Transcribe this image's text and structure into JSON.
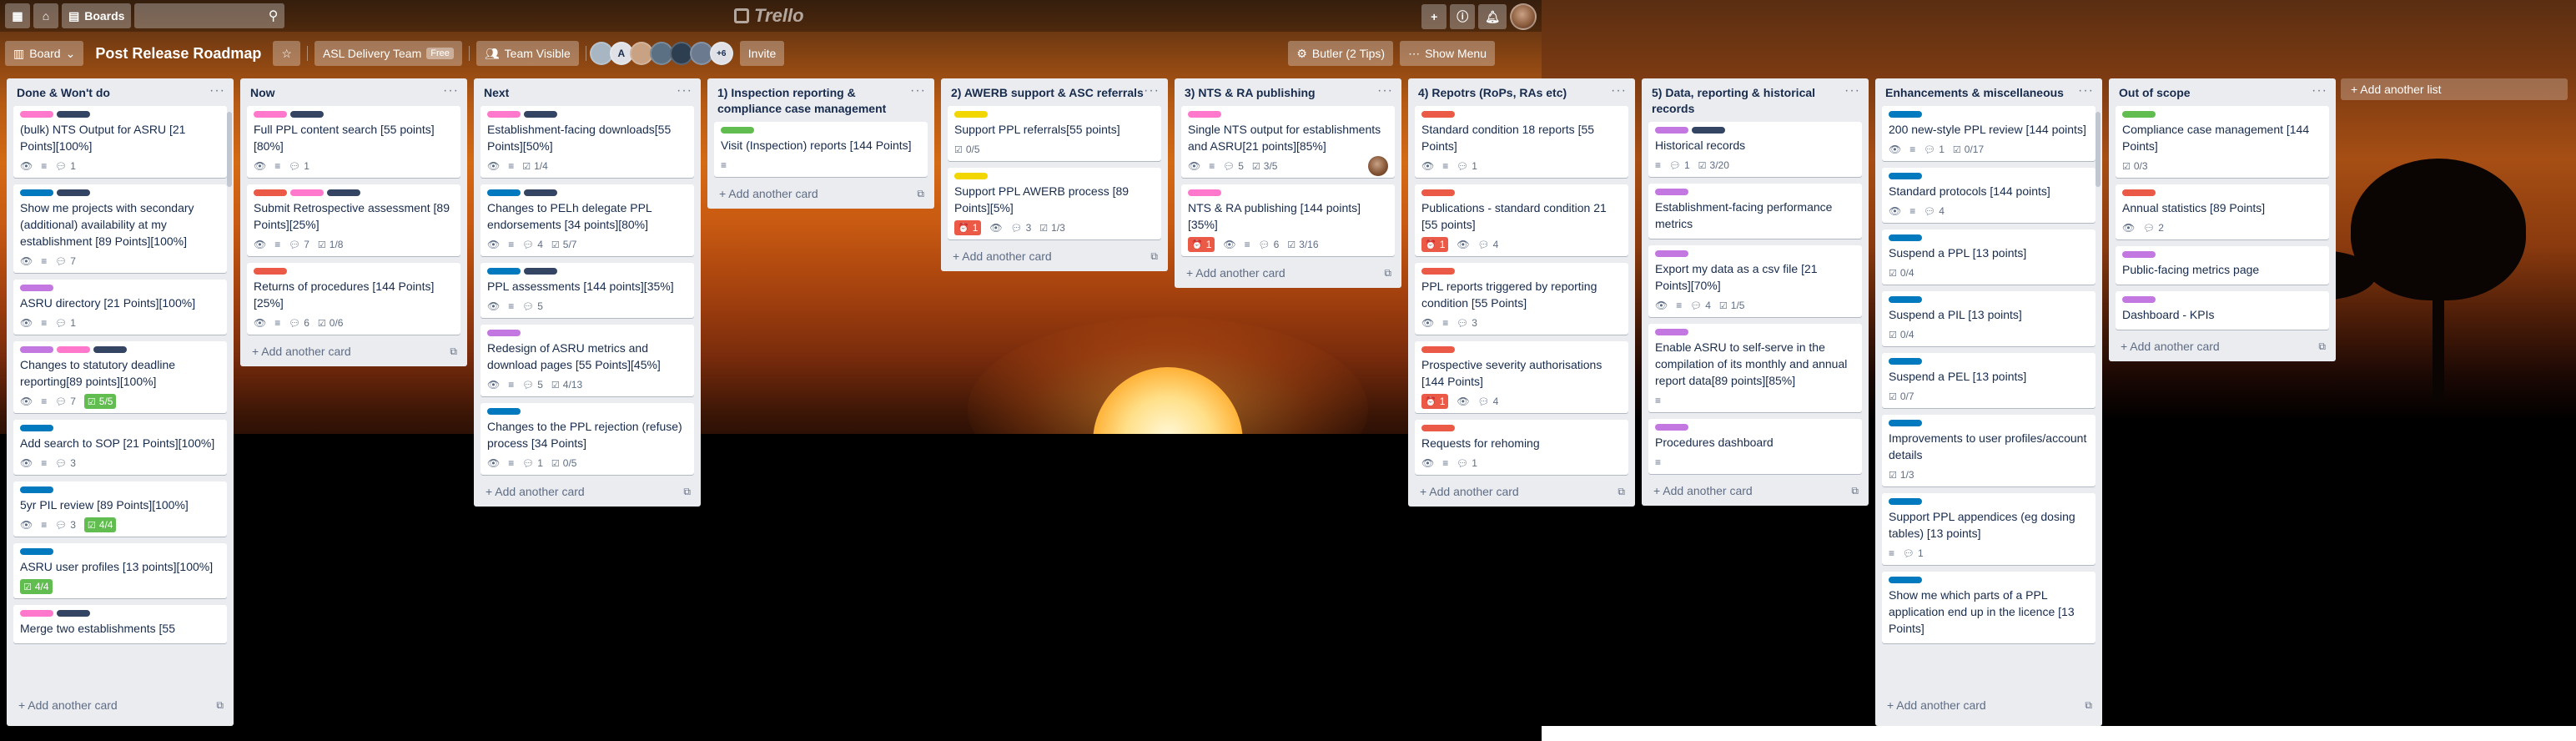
{
  "header": {
    "boards_label": "Boards",
    "logo_text": "Trello"
  },
  "boardbar": {
    "view_label": "Board",
    "title": "Post Release Roadmap",
    "team": "ASL Delivery Team",
    "team_badge": "Free",
    "visibility": "Team Visible",
    "member_initial": "A",
    "more_members": "+6",
    "invite": "Invite",
    "butler": "Butler (2 Tips)",
    "show_menu": "Show Menu"
  },
  "add_card_label": "+ Add another card",
  "add_list_label": "+ Add another list",
  "lists": [
    {
      "title": "Done & Won't do",
      "cards": [
        {
          "labels": [
            "pink",
            "navy"
          ],
          "title": "(bulk) NTS Output for ASRU [21 Points][100%]",
          "watch": true,
          "desc": true,
          "comments": "1"
        },
        {
          "labels": [
            "blue",
            "navy"
          ],
          "title": "Show me projects with secondary (additional) availability at my establishment [89 Points][100%]",
          "watch": true,
          "desc": true,
          "comments": "7"
        },
        {
          "labels": [
            "purple"
          ],
          "title": "ASRU directory [21 Points][100%]",
          "watch": true,
          "desc": true,
          "comments": "1"
        },
        {
          "labels": [
            "purple",
            "pink",
            "navy"
          ],
          "title": "Changes to statutory deadline reporting[89 points][100%]",
          "watch": true,
          "desc": true,
          "comments": "7",
          "checklist_done": "5/5"
        },
        {
          "labels": [
            "blue"
          ],
          "title": "Add search to SOP [21 Points][100%]",
          "watch": true,
          "desc": true,
          "comments": "3"
        },
        {
          "labels": [
            "blue"
          ],
          "title": "5yr PIL review [89 Points][100%]",
          "watch": true,
          "desc": true,
          "comments": "3",
          "checklist_done": "4/4"
        },
        {
          "labels": [
            "blue"
          ],
          "title": "ASRU user profiles [13 points][100%]",
          "checklist_done": "4/4"
        },
        {
          "labels": [
            "pink",
            "navy"
          ],
          "title": "Merge two establishments [55"
        }
      ]
    },
    {
      "title": "Now",
      "cards": [
        {
          "labels": [
            "pink",
            "navy"
          ],
          "title": "Full PPL content search [55 points][80%]",
          "watch": true,
          "desc": true,
          "comments": "1"
        },
        {
          "labels": [
            "red",
            "pink",
            "navy"
          ],
          "title": "Submit Retrospective assessment [89 Points][25%]",
          "watch": true,
          "desc": true,
          "comments": "7",
          "checklist": "1/8"
        },
        {
          "labels": [
            "red"
          ],
          "title": "Returns of procedures [144 Points][25%]",
          "watch": true,
          "desc": true,
          "comments": "6",
          "checklist": "0/6"
        }
      ]
    },
    {
      "title": "Next",
      "cards": [
        {
          "labels": [
            "pink",
            "navy"
          ],
          "title": "Establishment-facing downloads[55 Points][50%]",
          "watch": true,
          "desc": true,
          "checklist": "1/4"
        },
        {
          "labels": [
            "blue",
            "navy"
          ],
          "title": "Changes to PELh delegate PPL endorsements [34 points][80%]",
          "watch": true,
          "desc": true,
          "comments": "4",
          "checklist": "5/7"
        },
        {
          "labels": [
            "blue",
            "navy"
          ],
          "title": "PPL assessments [144 points][35%]",
          "watch": true,
          "desc": true,
          "comments": "5"
        },
        {
          "labels": [
            "purple"
          ],
          "title": "Redesign of ASRU metrics and download pages [55 Points][45%]",
          "watch": true,
          "desc": true,
          "comments": "5",
          "checklist": "4/13"
        },
        {
          "labels": [
            "blue"
          ],
          "title": "Changes to the PPL rejection (refuse) process [34 Points]",
          "watch": true,
          "desc": true,
          "comments": "1",
          "checklist": "0/5"
        }
      ]
    },
    {
      "title": "1) Inspection reporting & compliance case management",
      "cards": [
        {
          "labels": [
            "green"
          ],
          "title": "Visit (Inspection) reports [144 Points]",
          "desc": true
        }
      ]
    },
    {
      "title": "2) AWERB support & ASC referrals",
      "cards": [
        {
          "labels": [
            "yellow"
          ],
          "title": "Support PPL referrals[55 points]",
          "checklist": "0/5"
        },
        {
          "labels": [
            "yellow"
          ],
          "title": "Support PPL AWERB process [89 Points][5%]",
          "due": "1",
          "watch": true,
          "comments": "3",
          "checklist": "1/3"
        }
      ]
    },
    {
      "title": "3) NTS & RA publishing",
      "cards": [
        {
          "labels": [
            "pink"
          ],
          "title": "Single NTS output for establishments and ASRU[21 points][85%]",
          "watch": true,
          "desc": true,
          "comments": "5",
          "checklist": "3/5",
          "avatar": true
        },
        {
          "labels": [
            "pink"
          ],
          "title": "NTS & RA publishing [144 points][35%]",
          "due": "1",
          "watch": true,
          "desc": true,
          "comments": "6",
          "checklist": "3/16"
        }
      ]
    },
    {
      "title": "4) Repotrs (RoPs, RAs etc)",
      "cards": [
        {
          "labels": [
            "red"
          ],
          "title": "Standard condition 18 reports [55 Points]",
          "watch": true,
          "desc": true,
          "comments": "1"
        },
        {
          "labels": [
            "red"
          ],
          "title": "Publications - standard condition 21 [55 points]",
          "due": "1",
          "watch": true,
          "comments": "4"
        },
        {
          "labels": [
            "red"
          ],
          "title": "PPL reports triggered by reporting condition [55 Points]",
          "watch": true,
          "desc": true,
          "comments": "3"
        },
        {
          "labels": [
            "red"
          ],
          "title": "Prospective severity authorisations [144 Points]",
          "due": "1",
          "watch": true,
          "comments": "4"
        },
        {
          "labels": [
            "red"
          ],
          "title": "Requests for rehoming",
          "watch": true,
          "desc": true,
          "comments": "1"
        }
      ]
    },
    {
      "title": "5) Data, reporting & historical records",
      "cards": [
        {
          "labels": [
            "purple",
            "navy"
          ],
          "title": "Historical records",
          "desc": true,
          "comments": "1",
          "checklist": "3/20"
        },
        {
          "labels": [
            "purple"
          ],
          "title": "Establishment-facing performance metrics"
        },
        {
          "labels": [
            "purple"
          ],
          "title": "Export my data as a csv file [21 Points][70%]",
          "watch": true,
          "desc": true,
          "comments": "4",
          "checklist": "1/5"
        },
        {
          "labels": [
            "purple"
          ],
          "title": "Enable ASRU to self-serve in the compilation of its monthly and annual report data[89 points][85%]",
          "desc": true
        },
        {
          "labels": [
            "purple"
          ],
          "title": "Procedures dashboard",
          "desc": true
        }
      ]
    },
    {
      "title": "Enhancements & miscellaneous",
      "cards": [
        {
          "labels": [
            "blue"
          ],
          "title": "200 new-style PPL review [144 points]",
          "watch": true,
          "desc": true,
          "comments": "1",
          "checklist": "0/17"
        },
        {
          "labels": [
            "blue"
          ],
          "title": "Standard protocols [144 points]",
          "watch": true,
          "desc": true,
          "comments": "4"
        },
        {
          "labels": [
            "blue"
          ],
          "title": "Suspend a PPL [13 points]",
          "checklist": "0/4"
        },
        {
          "labels": [
            "blue"
          ],
          "title": "Suspend a PIL [13 points]",
          "checklist": "0/4"
        },
        {
          "labels": [
            "blue"
          ],
          "title": "Suspend a PEL [13 points]",
          "checklist": "0/7"
        },
        {
          "labels": [
            "blue"
          ],
          "title": "Improvements to user profiles/account details",
          "checklist": "1/3"
        },
        {
          "labels": [
            "blue"
          ],
          "title": "Support PPL appendices (eg dosing tables) [13 points]",
          "desc": true,
          "comments": "1"
        },
        {
          "labels": [
            "blue"
          ],
          "title": "Show me which parts of a PPL application end up in the licence [13 Points]"
        }
      ]
    },
    {
      "title": "Out of scope",
      "cards": [
        {
          "labels": [
            "green"
          ],
          "title": "Compliance case management [144 Points]",
          "checklist": "0/3"
        },
        {
          "labels": [
            "red"
          ],
          "title": "Annual statistics [89 Points]",
          "watch": true,
          "comments": "2"
        },
        {
          "labels": [
            "purple"
          ],
          "title": "Public-facing metrics page"
        },
        {
          "labels": [
            "purple"
          ],
          "title": "Dashboard - KPIs"
        }
      ]
    }
  ],
  "colors": {
    "pink": "#ff78cb",
    "navy": "#344563",
    "blue": "#0079bf",
    "red": "#eb5a46",
    "green": "#61bd4f",
    "yellow": "#f2d600",
    "purple": "#c377e0"
  }
}
